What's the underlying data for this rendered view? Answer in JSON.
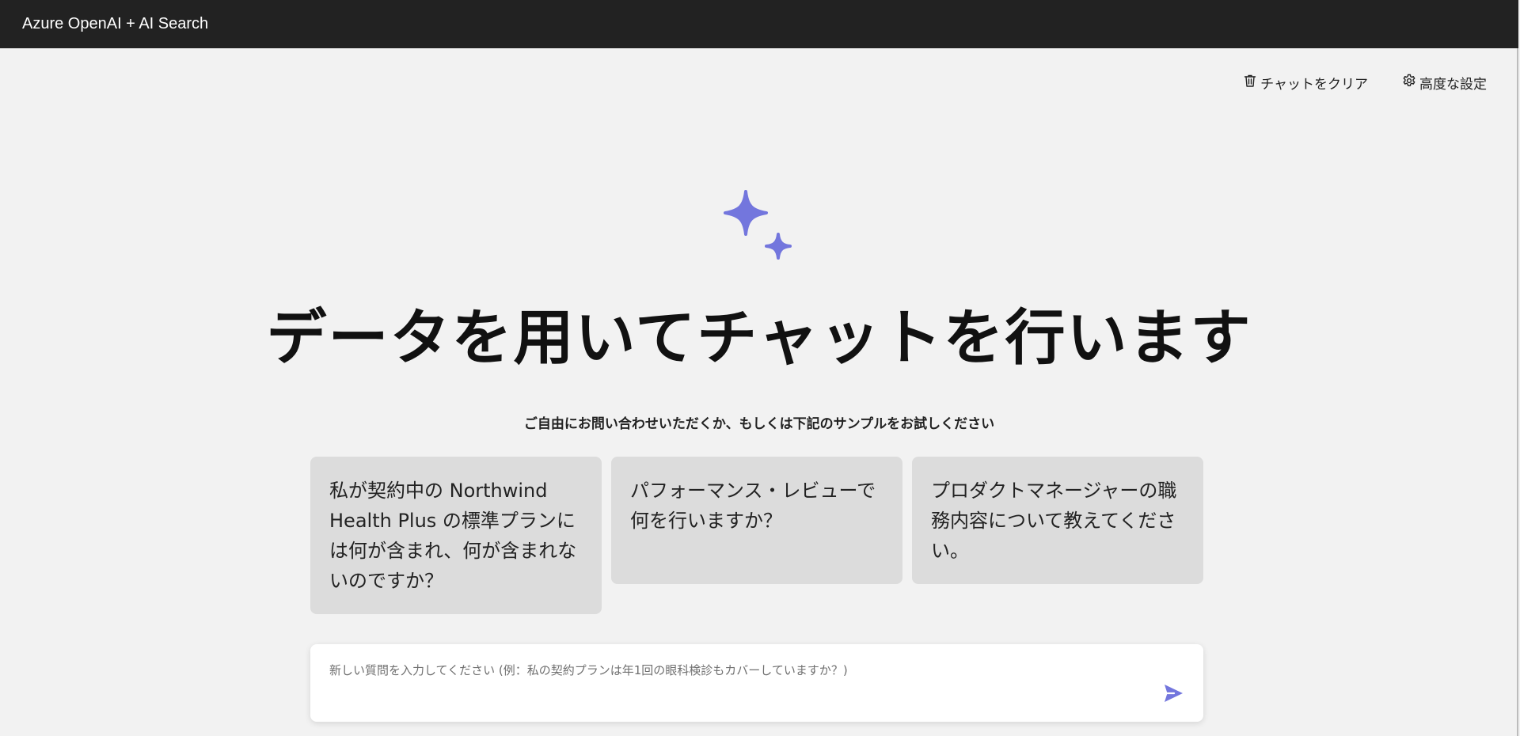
{
  "header": {
    "title": "Azure OpenAI + AI Search"
  },
  "toolbar": {
    "clear_chat_label": "チャットをクリア",
    "clear_chat_icon": "trash-icon",
    "settings_label": "高度な設定",
    "settings_icon": "gear-icon"
  },
  "hero": {
    "icon": "sparkle-icon",
    "accent_color": "#7376dd",
    "title": "データを用いてチャットを行います",
    "subtitle": "ご自由にお問い合わせいただくか、もしくは下記のサンプルをお試しください"
  },
  "examples": [
    {
      "text": "私が契約中の Northwind Health Plus の標準プランには何が含まれ、何が含まれないのですか？"
    },
    {
      "text": "パフォーマンス・レビューで何を行いますか？"
    },
    {
      "text": "プロダクトマネージャーの職務内容について教えてください。"
    }
  ],
  "question_input": {
    "placeholder": "新しい質問を入力してください (例：私の契約プランは年1回の眼科検診もカバーしていますか？)",
    "value": "",
    "send_icon": "send-icon"
  },
  "colors": {
    "header_bg": "#222222",
    "page_bg": "#f2f2f2",
    "card_bg": "#dcdcdc",
    "accent": "#7376dd"
  }
}
